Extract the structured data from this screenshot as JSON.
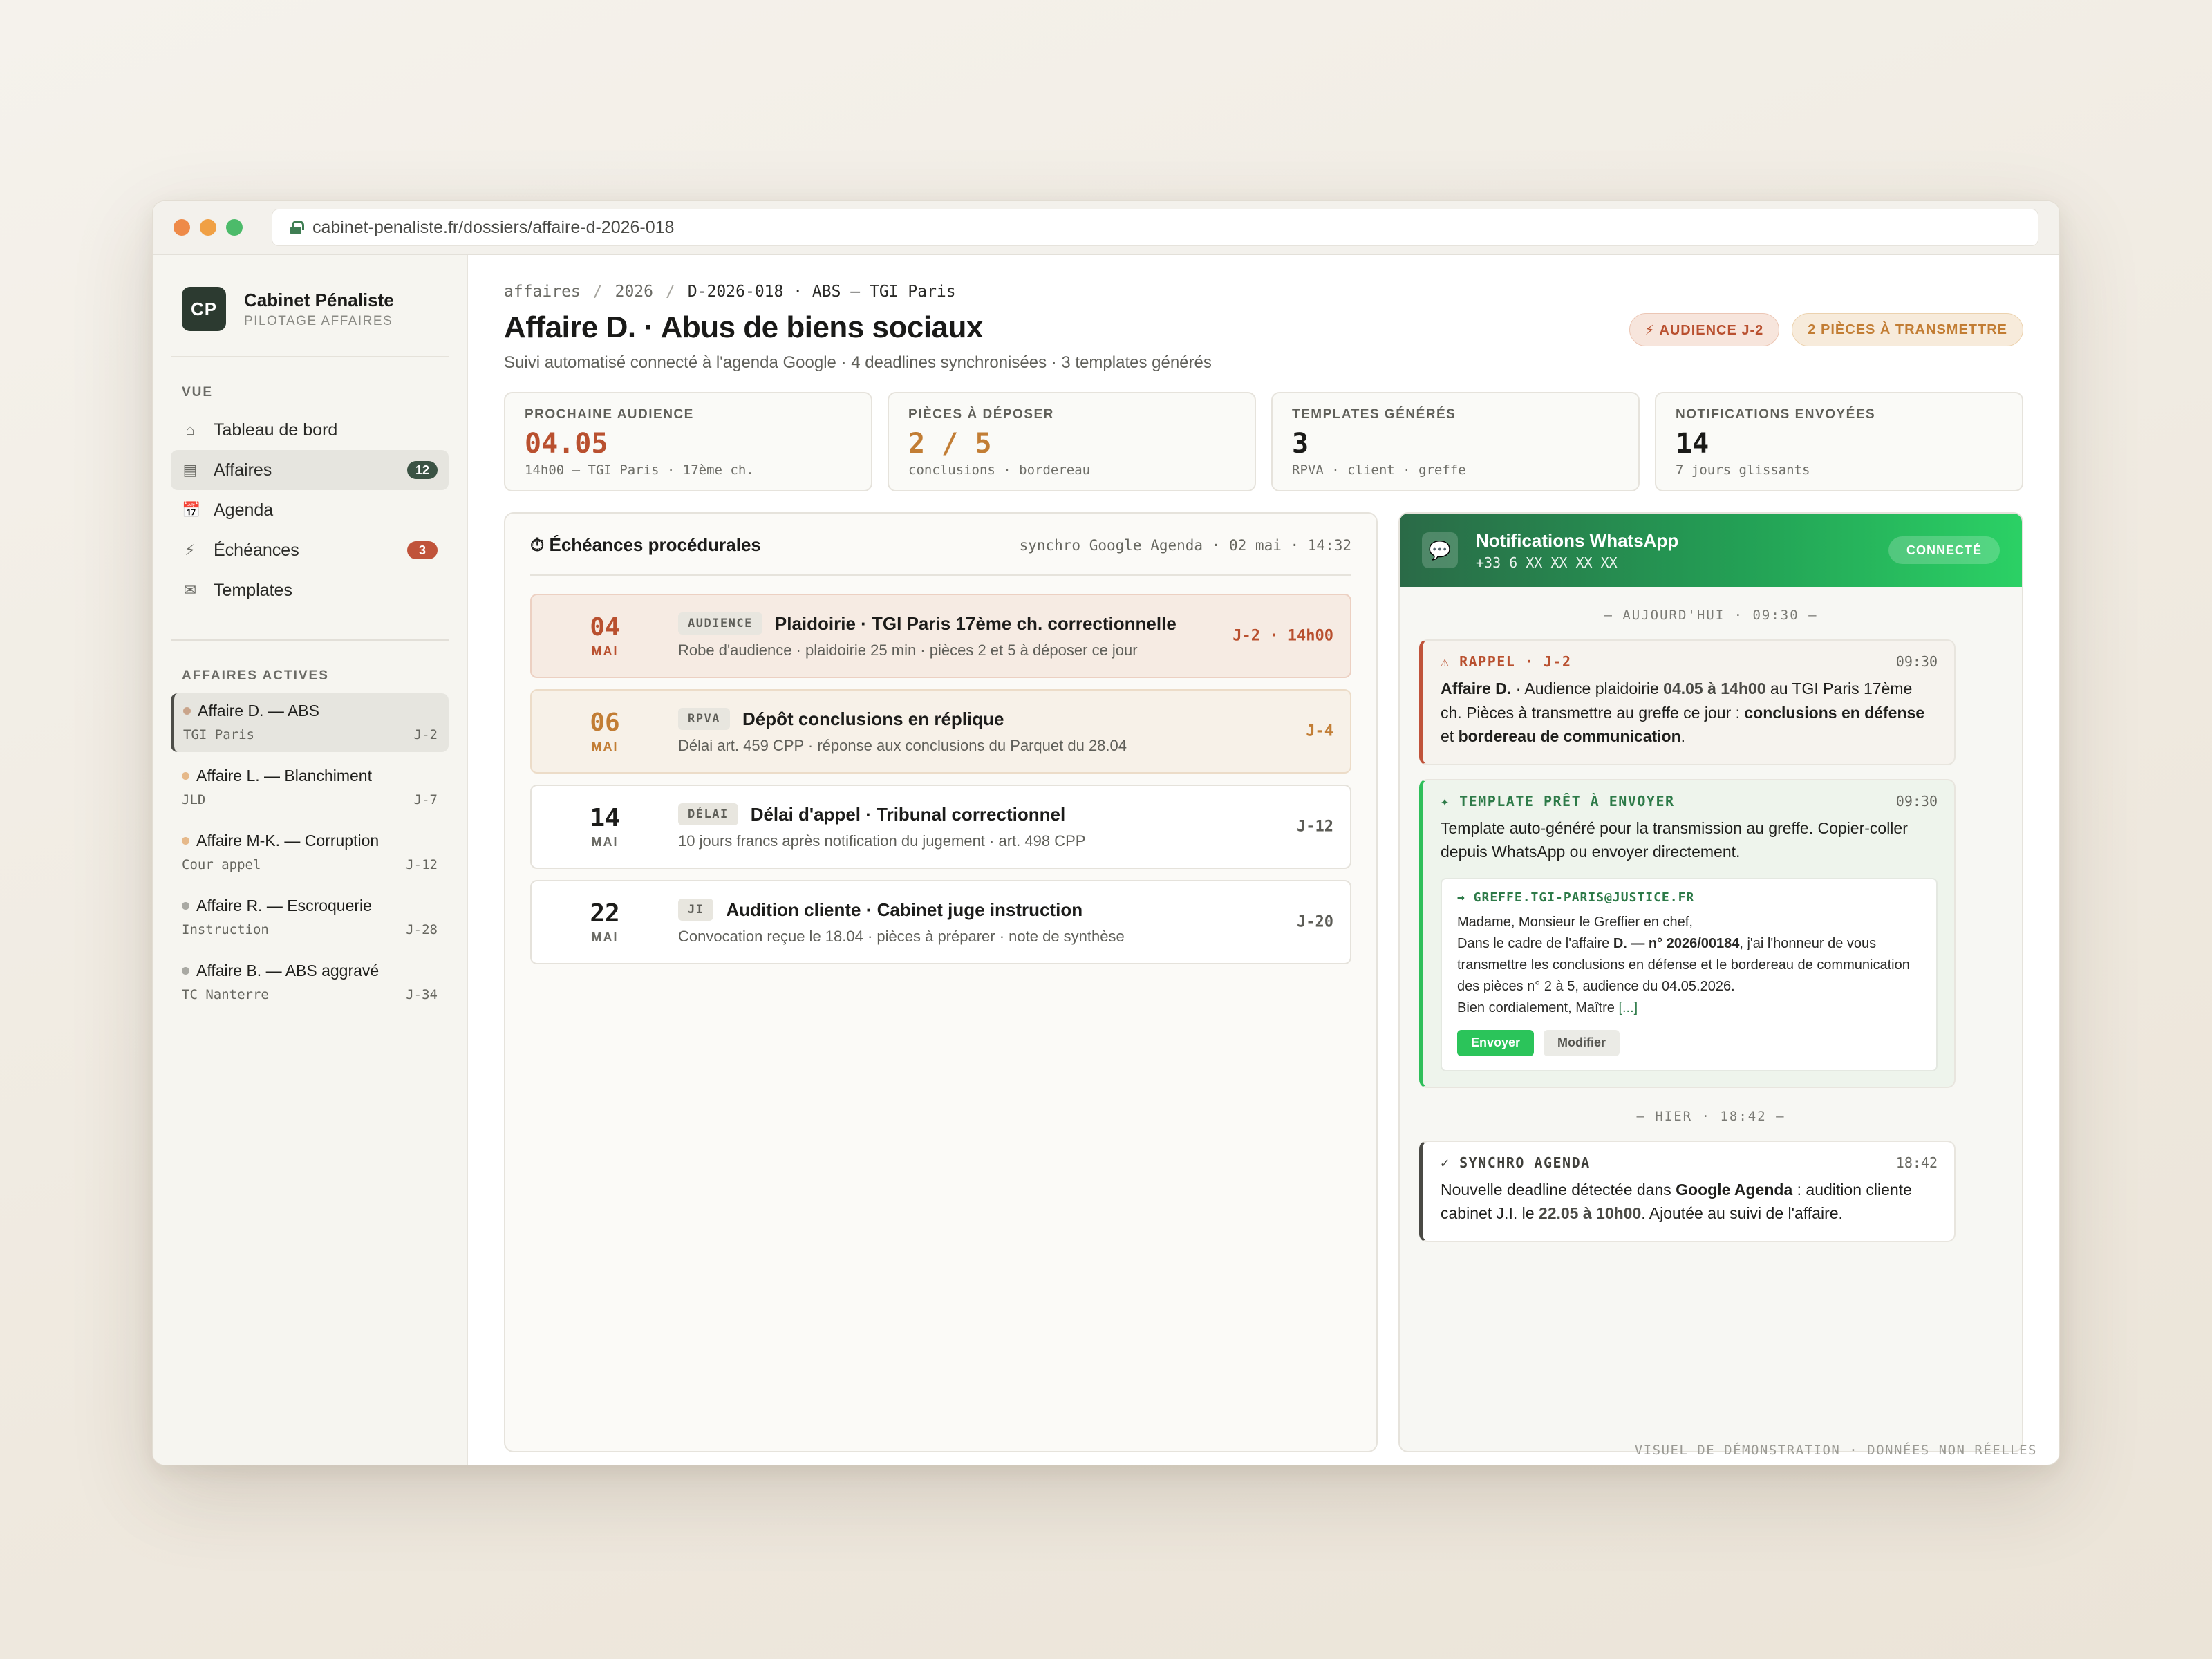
{
  "browser": {
    "url": "cabinet-penaliste.fr/dossiers/affaire-d-2026-018"
  },
  "sidebar": {
    "brand": {
      "logo": "CP",
      "name": "Cabinet Pénaliste",
      "tagline": "PILOTAGE AFFAIRES"
    },
    "nav_section": "VUE",
    "nav": [
      {
        "label": "Tableau de bord",
        "icon": "home-icon",
        "glyph": "⌂",
        "badge": ""
      },
      {
        "label": "Affaires",
        "icon": "folder-icon",
        "glyph": "▤",
        "badge": "12",
        "active": true
      },
      {
        "label": "Agenda",
        "icon": "calendar-icon",
        "glyph": "📅",
        "badge": ""
      },
      {
        "label": "Échéances",
        "icon": "lightning-icon",
        "glyph": "⚡",
        "badge": "3"
      },
      {
        "label": "Templates",
        "icon": "mail-icon",
        "glyph": "✉",
        "badge": ""
      }
    ],
    "cases_section": "AFFAIRES ACTIVES",
    "cases": [
      {
        "title": "Affaire D. — ABS",
        "court": "TGI Paris",
        "due": "J-2",
        "dot_color": "#c9a48a"
      },
      {
        "title": "Affaire L. — Blanchiment",
        "court": "JLD",
        "due": "J-7",
        "dot_color": "#e6b98a"
      },
      {
        "title": "Affaire M-K. — Corruption",
        "court": "Cour appel",
        "due": "J-12",
        "dot_color": "#e6b98a"
      },
      {
        "title": "Affaire R. — Escroquerie",
        "court": "Instruction",
        "due": "J-28",
        "dot_color": "#a9a9a3"
      },
      {
        "title": "Affaire B. — ABS aggravé",
        "court": "TC Nanterre",
        "due": "J-34",
        "dot_color": "#a9a9a3"
      }
    ]
  },
  "header": {
    "breadcrumb": [
      "affaires",
      "2026",
      "D-2026-018 · ABS — TGI Paris"
    ],
    "title": "Affaire D. · Abus de biens sociaux",
    "subtitle": "Suivi automatisé connecté à l'agenda Google · 4 deadlines synchronisées · 3 templates générés",
    "chip_hearing": "⚡ AUDIENCE J-2",
    "chip_docs": "2 PIÈCES À TRANSMETTRE"
  },
  "kpis": [
    {
      "label": "PROCHAINE AUDIENCE",
      "value": "04.05",
      "sub": "14h00 — TGI Paris · 17ème ch.",
      "color": "#b9502f"
    },
    {
      "label": "PIÈCES À DÉPOSER",
      "value": "2 / 5",
      "sub": "conclusions · bordereau",
      "color": "#c27d34"
    },
    {
      "label": "TEMPLATES GÉNÉRÉS",
      "value": "3",
      "sub": "RPVA · client · greffe",
      "color": "#1a1a18"
    },
    {
      "label": "NOTIFICATIONS ENVOYÉES",
      "value": "14",
      "sub": "7 jours glissants",
      "color": "#1a1a18"
    }
  ],
  "echeances": {
    "title": "⏱ Échéances procédurales",
    "sync": "synchro Google Agenda · 02 mai · 14:32",
    "rows": [
      {
        "day": "04",
        "month": "MAI",
        "tag": "AUDIENCE",
        "title": "Plaidoirie · TGI Paris 17ème ch. correctionnelle",
        "desc": "Robe d'audience · plaidoirie 25 min · pièces 2 et 5 à déposer ce jour",
        "due": "J-2 · 14h00",
        "tone": "red",
        "color": "#b9502f"
      },
      {
        "day": "06",
        "month": "MAI",
        "tag": "RPVA",
        "title": "Dépôt conclusions en réplique",
        "desc": "Délai art. 459 CPP · réponse aux conclusions du Parquet du 28.04",
        "due": "J-4",
        "tone": "amber",
        "color": "#c27d34"
      },
      {
        "day": "14",
        "month": "MAI",
        "tag": "DÉLAI",
        "title": "Délai d'appel · Tribunal correctionnel",
        "desc": "10 jours francs après notification du jugement · art. 498 CPP",
        "due": "J-12",
        "tone": "plain",
        "color": "#1c1c1a"
      },
      {
        "day": "22",
        "month": "MAI",
        "tag": "JI",
        "title": "Audition cliente · Cabinet juge instruction",
        "desc": "Convocation reçue le 18.04 · pièces à préparer · note de synthèse",
        "due": "J-20",
        "tone": "plain",
        "color": "#1c1c1a"
      }
    ]
  },
  "whatsapp": {
    "title": "Notifications WhatsApp",
    "phone": "+33 6 XX XX XX XX",
    "status": "CONNECTÉ",
    "sep_today": "— AUJOURD'HUI · 09:30 —",
    "sep_yesterday": "— HIER · 18:42 —",
    "rappel": {
      "label": "⚠ RAPPEL · J-2",
      "time": "09:30",
      "parts": {
        "case": "Affaire D.",
        "t1": " · Audience plaidoirie ",
        "when": "04.05 à 14h00",
        "t2": " au TGI Paris 17ème ch. Pièces à transmettre au greffe ce jour : ",
        "doc1": "conclusions en défense",
        "t3": " et ",
        "doc2": "bordereau de communication",
        "t4": "."
      }
    },
    "template": {
      "label": "✦ TEMPLATE PRÊT À ENVOYER",
      "time": "09:30",
      "text": "Template auto-généré pour la transmission au greffe. Copier-coller depuis WhatsApp ou envoyer directement.",
      "mail_to": "→ GREFFE.TGI-PARIS@JUSTICE.FR",
      "mail": {
        "greeting": "Madame, Monsieur le Greffier en chef,",
        "t1": "Dans le cadre de l'affaire ",
        "ref": "D. — n° 2026/00184",
        "t2": ", j'ai l'honneur de vous transmettre les conclusions en défense et le bordereau de communication des pièces n° 2 à 5, audience du 04.05.2026.",
        "closing": "Bien cordialement, Maître ",
        "more": "[...]"
      },
      "btn_send": "Envoyer",
      "btn_edit": "Modifier"
    },
    "synchro": {
      "label": "✓ SYNCHRO AGENDA",
      "time": "18:42",
      "parts": {
        "t1": "Nouvelle deadline détectée dans ",
        "src": "Google Agenda",
        "t2": " : audition cliente cabinet J.I. le ",
        "when": "22.05 à 10h00",
        "t3": ". Ajoutée au suivi de l'affaire."
      }
    }
  },
  "footer": "VISUEL DE DÉMONSTRATION · DONNÉES NON RÉELLES"
}
